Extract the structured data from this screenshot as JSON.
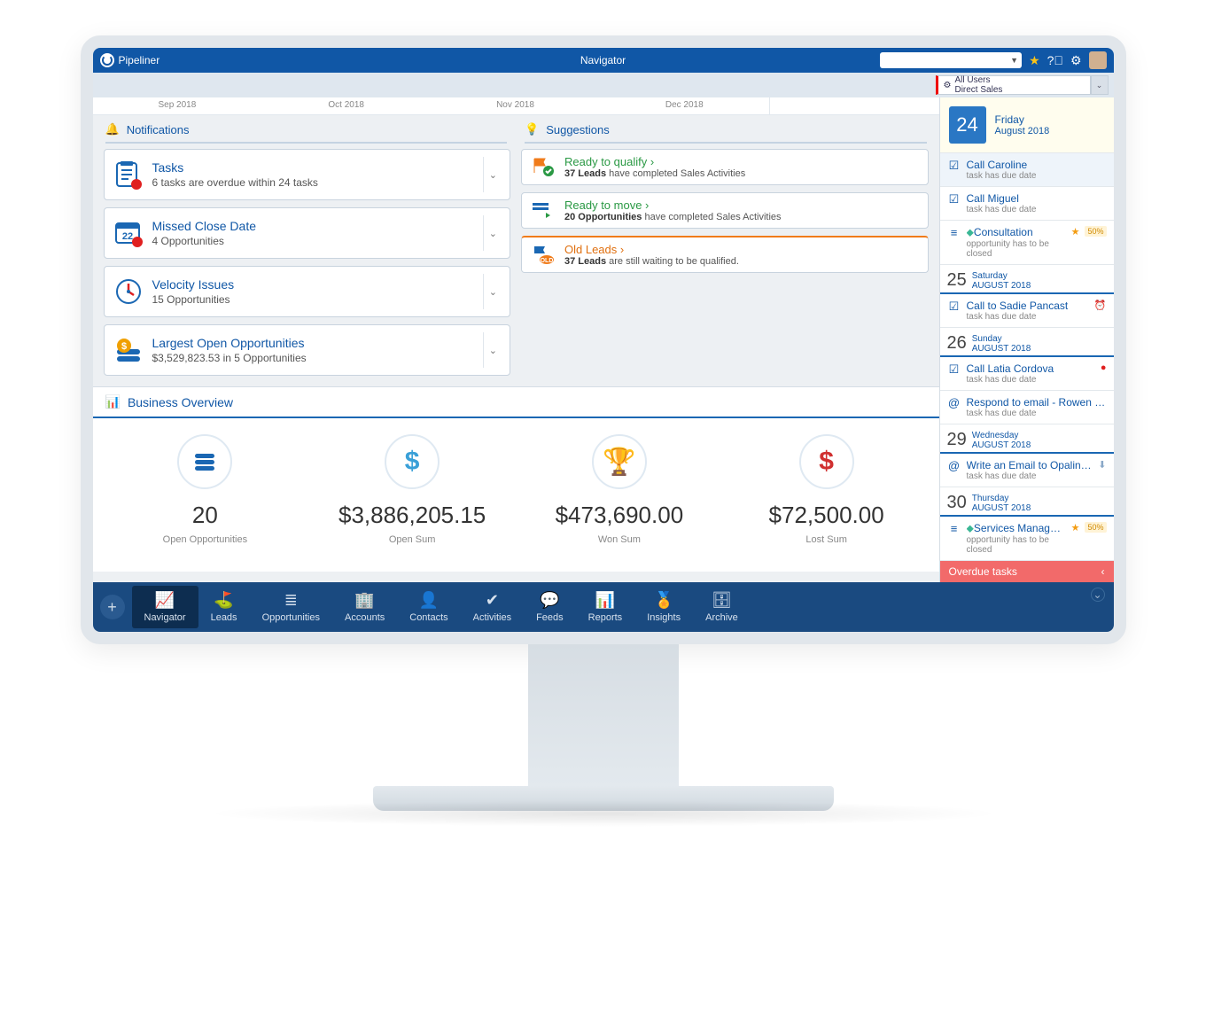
{
  "header": {
    "brand": "Pipeliner",
    "title": "Navigator",
    "filter_line1": "All Users",
    "filter_line2": "Direct Sales"
  },
  "timeline": [
    "Sep 2018",
    "Oct 2018",
    "Nov 2018",
    "Dec 2018"
  ],
  "sections": {
    "notifications": "Notifications",
    "suggestions": "Suggestions",
    "business": "Business Overview"
  },
  "notifications": [
    {
      "title": "Tasks",
      "sub": "6 tasks are overdue within 24 tasks"
    },
    {
      "title": "Missed Close Date",
      "sub": "4 Opportunities"
    },
    {
      "title": "Velocity Issues",
      "sub": "15 Opportunities"
    },
    {
      "title": "Largest Open Opportunities",
      "sub": "$3,529,823.53 in 5 Opportunities"
    }
  ],
  "suggestions": [
    {
      "title": "Ready to qualify ›",
      "bold": "37 Leads",
      "rest": " have completed Sales Activities",
      "tone": "green"
    },
    {
      "title": "Ready to move ›",
      "bold": "20 Opportunities",
      "rest": " have completed Sales Activities",
      "tone": "green"
    },
    {
      "title": "Old Leads ›",
      "bold": "37 Leads",
      "rest": " are still waiting to be qualified.",
      "tone": "orange"
    }
  ],
  "business": [
    {
      "value": "20",
      "label": "Open Opportunities",
      "icon": "list",
      "color": "#1a67b3"
    },
    {
      "value": "$3,886,205.15",
      "label": "Open Sum",
      "icon": "dollar",
      "color": "#3aa0d8"
    },
    {
      "value": "$473,690.00",
      "label": "Won Sum",
      "icon": "trophy",
      "color": "#e6b400"
    },
    {
      "value": "$72,500.00",
      "label": "Lost Sum",
      "icon": "dollar",
      "color": "#d03030"
    }
  ],
  "calendar": {
    "hero": {
      "day": "24",
      "dow": "Friday",
      "month": "August 2018"
    },
    "blocks": [
      {
        "type": "item",
        "icon": "task",
        "title": "Call Caroline",
        "sub": "task has due date",
        "hl": true
      },
      {
        "type": "item",
        "icon": "task",
        "title": "Call Miguel",
        "sub": "task has due date"
      },
      {
        "type": "item",
        "icon": "opp",
        "title": "Consultation",
        "sub": "opportunity has to be closed",
        "star": true,
        "pct": "50%"
      },
      {
        "type": "date",
        "num": "25",
        "dow": "Saturday",
        "mon": "AUGUST 2018"
      },
      {
        "type": "item",
        "icon": "task",
        "title": "Call to Sadie Pancast",
        "sub": "task has due date",
        "clock": true
      },
      {
        "type": "date",
        "num": "26",
        "dow": "Sunday",
        "mon": "AUGUST 2018"
      },
      {
        "type": "item",
        "icon": "task",
        "title": "Call Latia Cordova",
        "sub": "task has due date",
        "alert": true
      },
      {
        "type": "item",
        "icon": "email",
        "title": "Respond to email - Rowen Wilders…",
        "sub": "task has due date"
      },
      {
        "type": "date",
        "num": "29",
        "dow": "Wednesday",
        "mon": "AUGUST 2018"
      },
      {
        "type": "item",
        "icon": "email",
        "title": "Write an Email to Opaline Gravy",
        "sub": "task has due date",
        "down": true
      },
      {
        "type": "date",
        "num": "30",
        "dow": "Thursday",
        "mon": "AUGUST 2018"
      },
      {
        "type": "item",
        "icon": "opp",
        "title": "Services Management",
        "sub": "opportunity has to be closed",
        "star": true,
        "pct": "50%"
      }
    ],
    "overdue": "Overdue tasks"
  },
  "nav": [
    {
      "label": "Navigator",
      "active": true
    },
    {
      "label": "Leads"
    },
    {
      "label": "Opportunities"
    },
    {
      "label": "Accounts"
    },
    {
      "label": "Contacts"
    },
    {
      "label": "Activities"
    },
    {
      "label": "Feeds"
    },
    {
      "label": "Reports"
    },
    {
      "label": "Insights"
    },
    {
      "label": "Archive"
    }
  ]
}
